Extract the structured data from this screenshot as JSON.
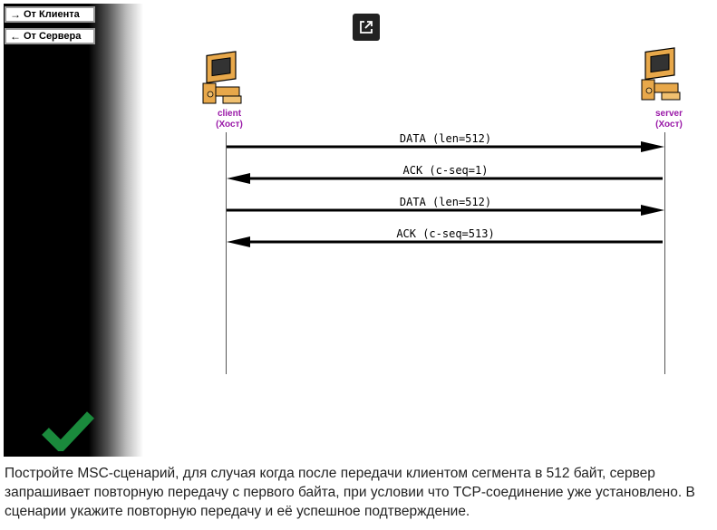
{
  "buttons": {
    "from_client": {
      "arrow": "→",
      "label": "От Клиента"
    },
    "from_server": {
      "arrow": "←",
      "label": "От Сервера"
    }
  },
  "icons": {
    "popout": "external-link-icon",
    "check": "checkmark-icon",
    "host": "computer-icon"
  },
  "colors": {
    "check": "#1a8a3c",
    "host_label": "#9a1aa8",
    "panel": "#000000"
  },
  "hosts": [
    {
      "name": "client",
      "role": "(Хост)"
    },
    {
      "name": "server",
      "role": "(Хост)"
    }
  ],
  "messages": [
    {
      "label": "DATA (len=512)",
      "direction": "client-to-server"
    },
    {
      "label": "ACK (c-seq=1)",
      "direction": "server-to-client"
    },
    {
      "label": "DATA (len=512)",
      "direction": "client-to-server"
    },
    {
      "label": "ACK (c-seq=513)",
      "direction": "server-to-client"
    }
  ],
  "task_text": "Постройте MSC-сценарий, для случая когда после передачи клиентом сегмента в 512 байт, сервер запрашивает повторную передачу с первого байта, при условии что TCP-соединение уже установлено. В сценарии укажите повторную передачу и её успешное подтверждение."
}
